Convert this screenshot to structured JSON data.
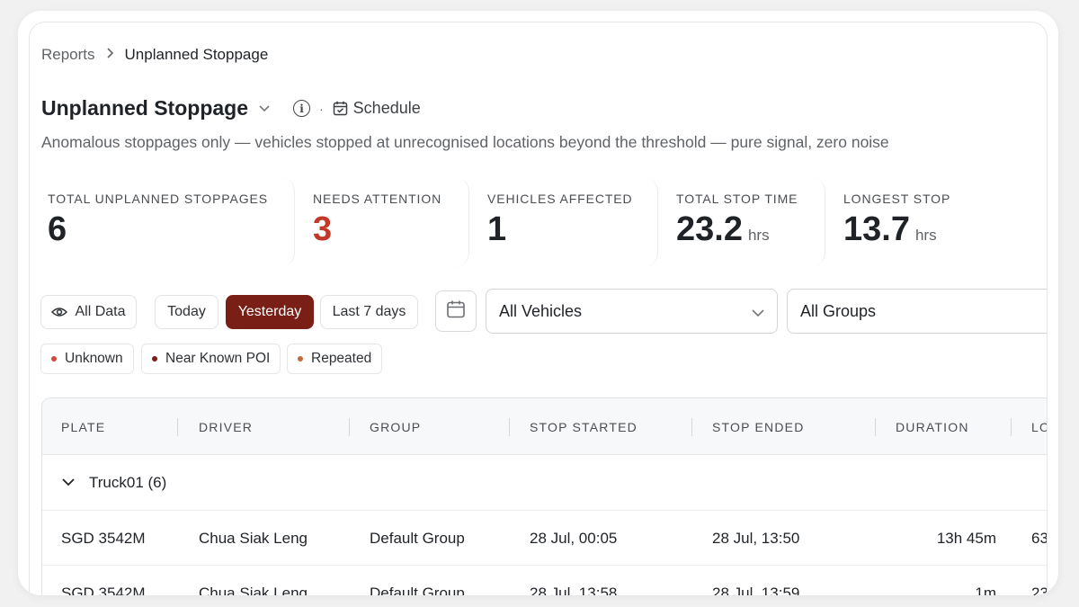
{
  "breadcrumb": {
    "parent": "Reports",
    "current": "Unplanned Stoppage"
  },
  "header": {
    "title": "Unplanned Stoppage",
    "schedule_label": "Schedule",
    "dot": "·",
    "subtitle": "Anomalous stoppages only — vehicles stopped at unrecognised locations beyond the threshold — pure signal, zero noise"
  },
  "stats": [
    {
      "label": "TOTAL UNPLANNED STOPPAGES",
      "value": "6",
      "unit": ""
    },
    {
      "label": "NEEDS ATTENTION",
      "value": "3",
      "unit": ""
    },
    {
      "label": "VEHICLES AFFECTED",
      "value": "1",
      "unit": ""
    },
    {
      "label": "TOTAL STOP TIME",
      "value": "23.2",
      "unit": "hrs"
    },
    {
      "label": "LONGEST STOP",
      "value": "13.7",
      "unit": "hrs"
    }
  ],
  "filters": {
    "all_data": "All Data",
    "today": "Today",
    "yesterday": "Yesterday",
    "last7": "Last 7 days",
    "active_range": "Yesterday",
    "vehicles": "All Vehicles",
    "groups": "All Groups"
  },
  "legend": [
    {
      "label": "Unknown",
      "color": "#d0493a"
    },
    {
      "label": "Near Known POI",
      "color": "#7a1f16"
    },
    {
      "label": "Repeated",
      "color": "#c26a3a"
    }
  ],
  "colors": {
    "accent": "#7a1f16",
    "alert": "#c0392b"
  },
  "table": {
    "columns": [
      "PLATE",
      "DRIVER",
      "GROUP",
      "STOP STARTED",
      "STOP ENDED",
      "DURATION",
      "LO"
    ],
    "group": {
      "label": "Truck01 (6)"
    },
    "rows": [
      {
        "plate": "SGD 3542M",
        "driver": "Chua Siak Leng",
        "group": "Default Group",
        "started": "28 Jul, 00:05",
        "ended": "28 Jul, 13:50",
        "duration": "13h 45m",
        "loc": "63"
      },
      {
        "plate": "SGD 3542M",
        "driver": "Chua Siak Leng",
        "group": "Default Group",
        "started": "28 Jul, 13:58",
        "ended": "28 Jul, 13:59",
        "duration": "1m",
        "loc": "23"
      }
    ]
  }
}
